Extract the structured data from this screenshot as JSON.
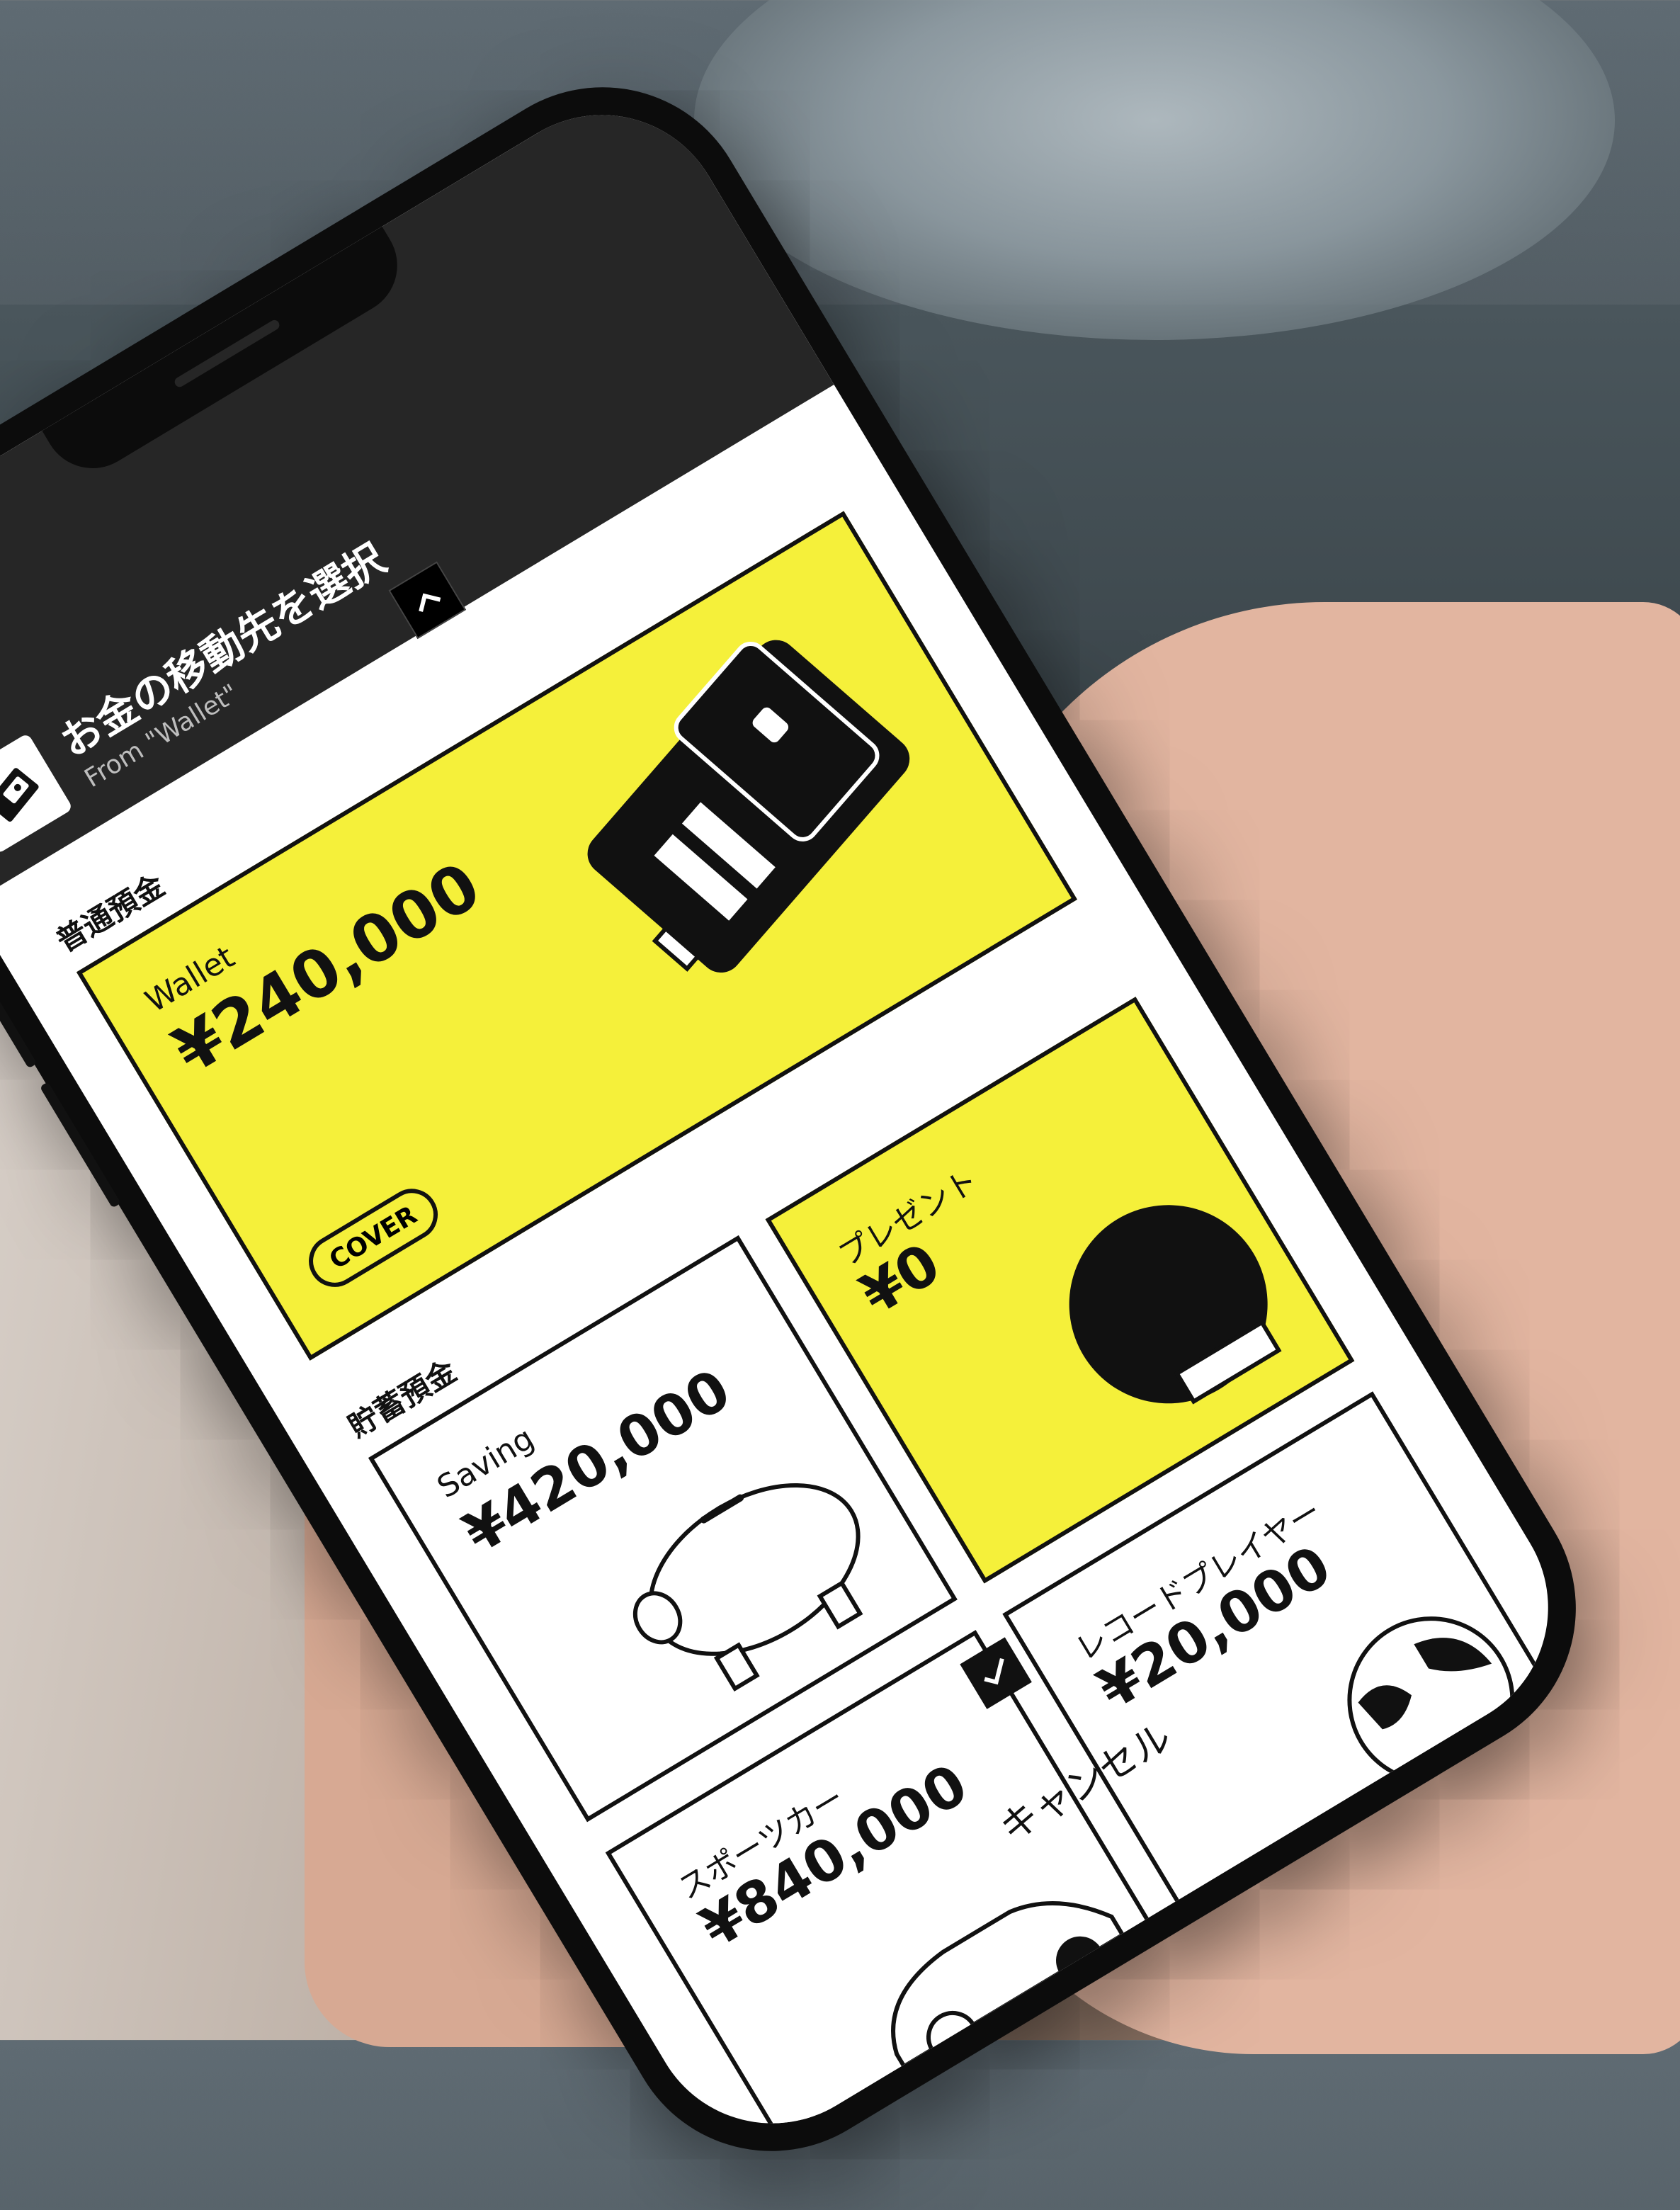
{
  "header": {
    "title": "お金の移動先を選択",
    "subtitle": "From \"Wallet\"",
    "collapse_icon": "chevron-up-icon",
    "wallet_icon": "wallet-icon"
  },
  "sections": {
    "ordinary": "普通預金",
    "savings": "貯蓄預金"
  },
  "cards": {
    "wallet": {
      "name": "Wallet",
      "amount": "¥240,000",
      "badge": "COVER"
    },
    "present": {
      "name": "プレゼント",
      "amount": "¥0"
    },
    "saving": {
      "name": "Saving",
      "amount": "¥420,000"
    },
    "record_player": {
      "name": "レコードプレイヤー",
      "amount": "¥20,000"
    },
    "sports_car": {
      "name": "スポーツカー",
      "amount": "¥840,000"
    }
  },
  "footer": {
    "cancel_label": "キャンセル"
  },
  "colors": {
    "accent_yellow": "#f5f03a",
    "header_dark": "#262626",
    "ink": "#111111"
  }
}
